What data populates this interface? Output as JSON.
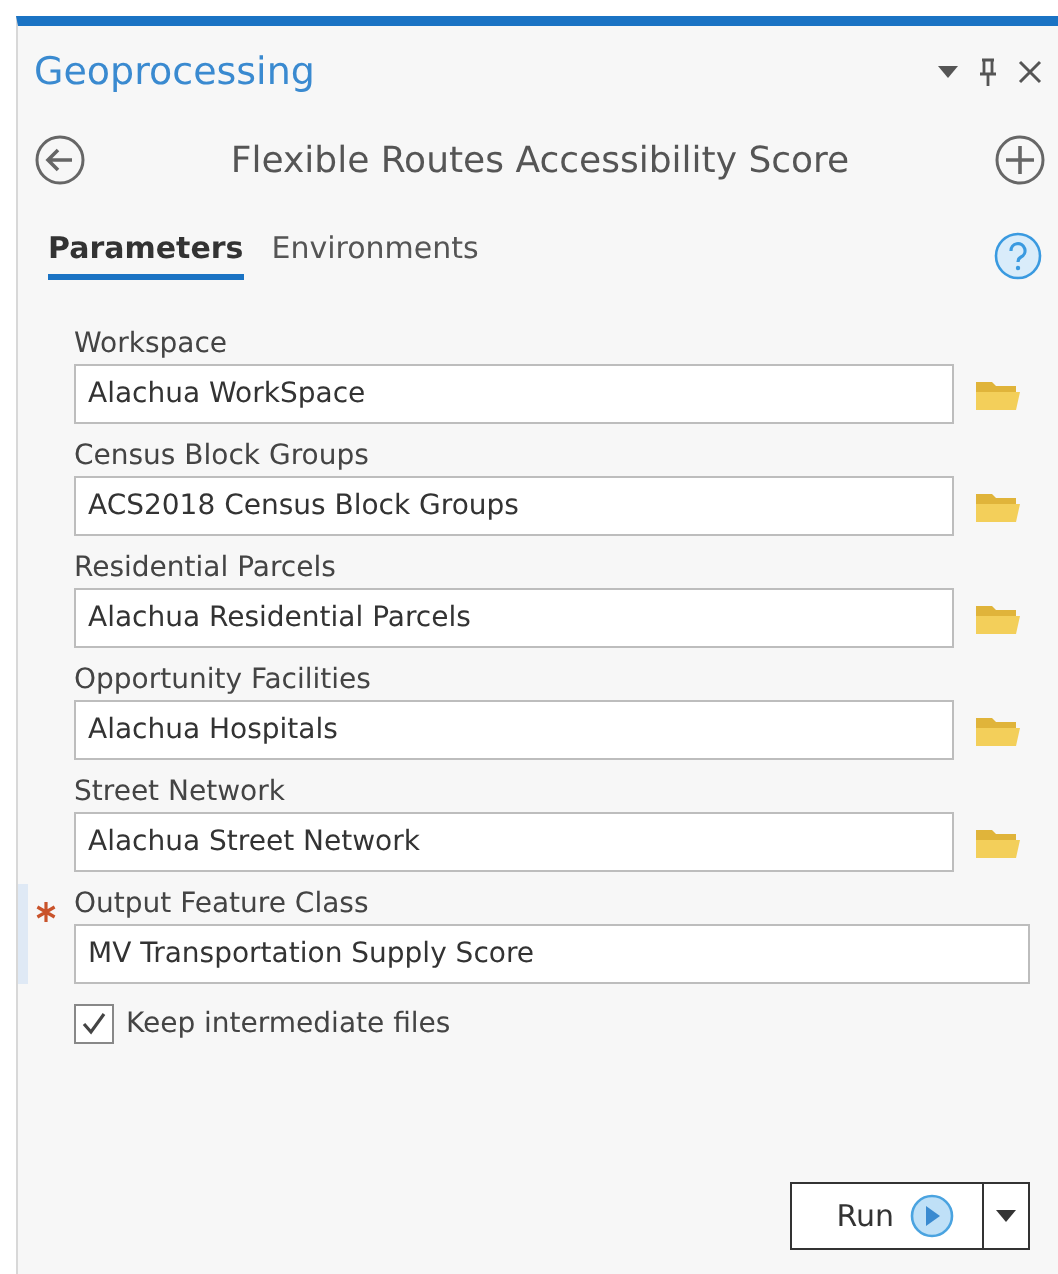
{
  "pane": {
    "title": "Geoprocessing"
  },
  "tool": {
    "title": "Flexible Routes Accessibility Score"
  },
  "tabs": [
    {
      "label": "Parameters",
      "selected": true
    },
    {
      "label": "Environments",
      "selected": false
    }
  ],
  "parameters": [
    {
      "label": "Workspace",
      "value": "Alachua WorkSpace",
      "kind": "input",
      "required": false
    },
    {
      "label": "Census Block Groups",
      "value": "ACS2018 Census Block Groups",
      "kind": "input",
      "required": false
    },
    {
      "label": "Residential Parcels",
      "value": "Alachua Residential Parcels",
      "kind": "input",
      "required": false
    },
    {
      "label": "Opportunity Facilities",
      "value": "Alachua Hospitals",
      "kind": "input",
      "required": false
    },
    {
      "label": "Street Network",
      "value": "Alachua Street Network",
      "kind": "input",
      "required": false
    },
    {
      "label": "Output Feature Class",
      "value": "MV Transportation Supply Score",
      "kind": "output",
      "required": true
    }
  ],
  "options": [
    {
      "label": "Keep intermediate files",
      "checked": true
    }
  ],
  "run_button": {
    "label": "Run"
  }
}
